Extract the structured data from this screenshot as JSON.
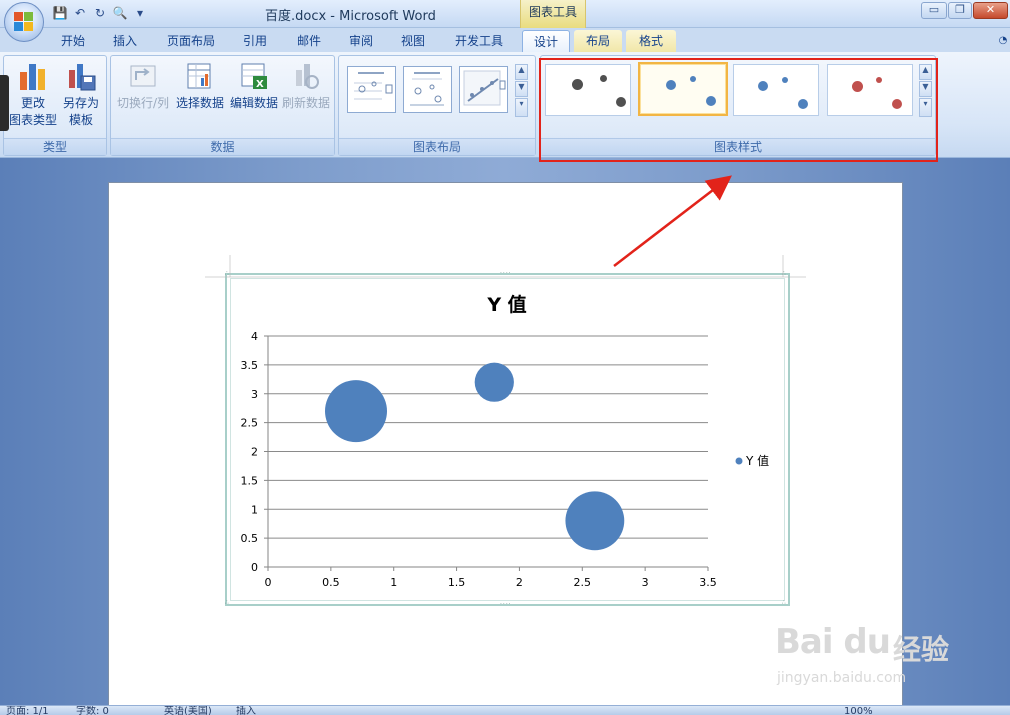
{
  "window": {
    "title": "百度.docx - Microsoft Word",
    "context_tab_title": "图表工具",
    "controls": {
      "minimize": "▭",
      "restore": "❐",
      "close": "✕"
    }
  },
  "quick_access": [
    {
      "name": "save-icon",
      "glyph": "💾"
    },
    {
      "name": "undo-icon",
      "glyph": "↶"
    },
    {
      "name": "redo-icon",
      "glyph": "↻"
    },
    {
      "name": "print-preview-icon",
      "glyph": "🔍"
    },
    {
      "name": "customize-icon",
      "glyph": "▾"
    }
  ],
  "tabs": [
    {
      "label": "开始",
      "state": "normal"
    },
    {
      "label": "插入",
      "state": "normal"
    },
    {
      "label": "页面布局",
      "state": "normal"
    },
    {
      "label": "引用",
      "state": "normal"
    },
    {
      "label": "邮件",
      "state": "normal"
    },
    {
      "label": "审阅",
      "state": "normal"
    },
    {
      "label": "视图",
      "state": "normal"
    },
    {
      "label": "开发工具",
      "state": "normal"
    },
    {
      "label": "设计",
      "state": "active"
    },
    {
      "label": "布局",
      "state": "context"
    },
    {
      "label": "格式",
      "state": "context"
    }
  ],
  "ribbon": {
    "groups": [
      {
        "label": "类型",
        "buttons": [
          {
            "label_line1": "更改",
            "label_line2": "图表类型",
            "icon": "change-chart-type-icon"
          },
          {
            "label_line1": "另存为",
            "label_line2": "模板",
            "icon": "save-as-template-icon"
          }
        ]
      },
      {
        "label": "数据",
        "buttons": [
          {
            "label_line1": "切换行/列",
            "icon": "switch-row-column-icon",
            "disabled": true
          },
          {
            "label_line1": "选择数据",
            "icon": "select-data-icon"
          },
          {
            "label_line1": "编辑数据",
            "icon": "edit-data-icon"
          },
          {
            "label_line1": "刷新数据",
            "icon": "refresh-data-icon",
            "disabled": true
          }
        ]
      },
      {
        "label": "图表布局"
      },
      {
        "label": "图表样式"
      }
    ],
    "style_colors": [
      "#505050",
      "#4f81bd",
      "#4f81bd",
      "#c0504d"
    ]
  },
  "chart": {
    "frame_color": "#a8cfc9",
    "bubble_color": "#4f81bd"
  },
  "chart_data": {
    "type": "bubble",
    "title": "Y 值",
    "xlim": [
      0,
      3.5
    ],
    "ylim": [
      0,
      4
    ],
    "x_ticks": [
      "0",
      "0.5",
      "1",
      "1.5",
      "2",
      "2.5",
      "3",
      "3.5"
    ],
    "y_ticks": [
      "0",
      "0.5",
      "1",
      "1.5",
      "2",
      "2.5",
      "3",
      "3.5",
      "4"
    ],
    "gridlines": "horizontal",
    "legend_position": "right",
    "series": [
      {
        "name": "Y 值",
        "points": [
          {
            "x": 0.7,
            "y": 2.7,
            "size": 10
          },
          {
            "x": 1.8,
            "y": 3.2,
            "size": 4
          },
          {
            "x": 2.6,
            "y": 0.8,
            "size": 9
          }
        ]
      }
    ]
  },
  "statusbar": {
    "page": "页面: 1/1",
    "words": "字数: 0",
    "language": "英语(美国)",
    "mode": "插入",
    "zoom": "100%"
  },
  "watermark": {
    "logo": "Bai du",
    "cn": "经验",
    "url": "jingyan.baidu.com"
  }
}
